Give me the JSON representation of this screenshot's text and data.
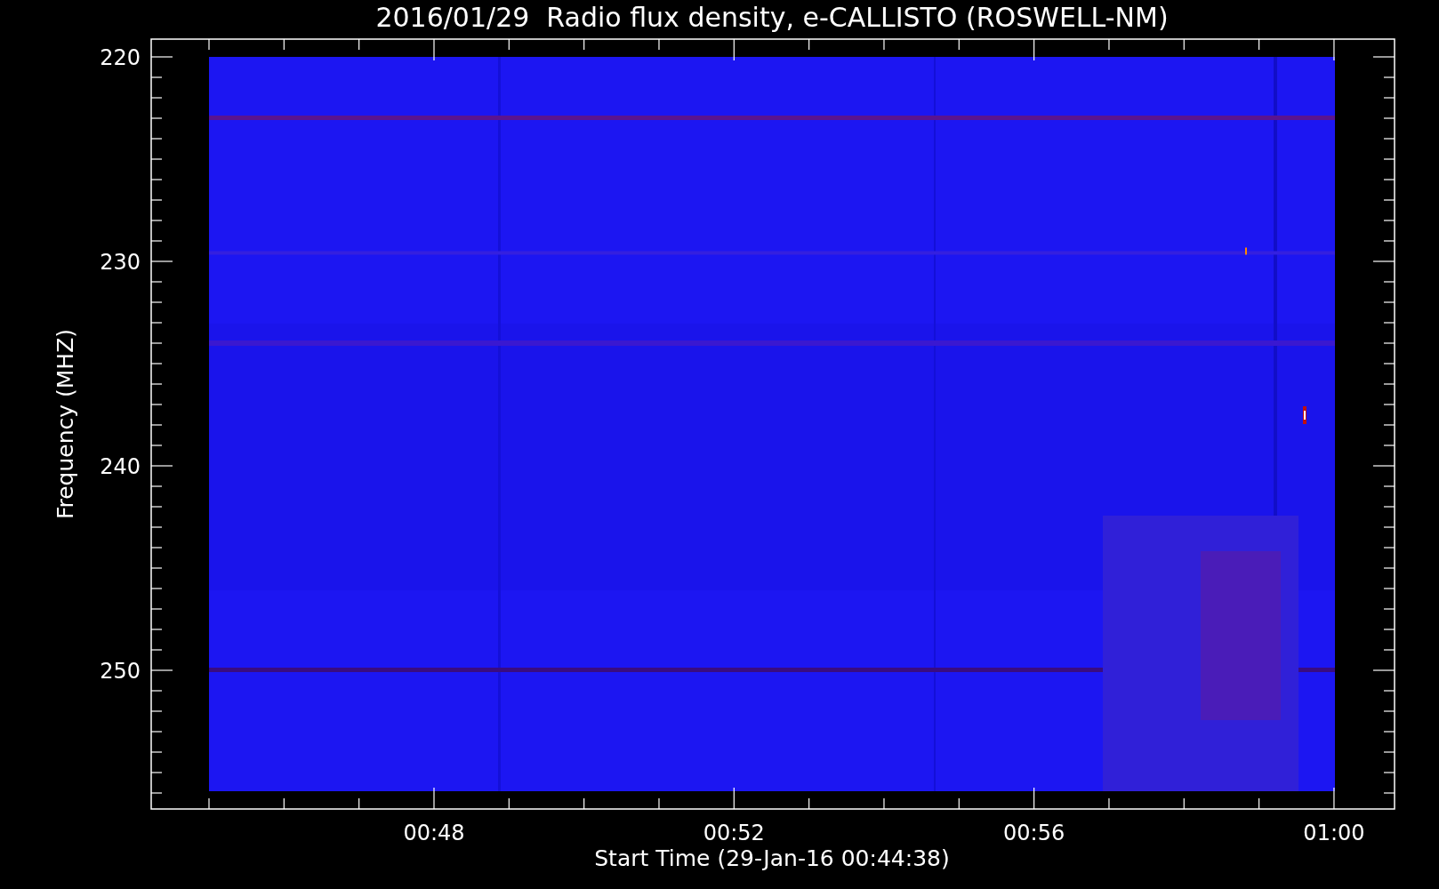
{
  "title": "2016/01/29  Radio flux density, e-CALLISTO (ROSWELL-NM)",
  "y_axis": {
    "label": "Frequency (MHZ)",
    "ticks": [
      "220",
      "230",
      "240",
      "250"
    ]
  },
  "x_axis": {
    "label": "Start Time (29-Jan-16 00:44:38)",
    "ticks": [
      "00:48",
      "00:52",
      "00:56",
      "01:00"
    ]
  }
}
